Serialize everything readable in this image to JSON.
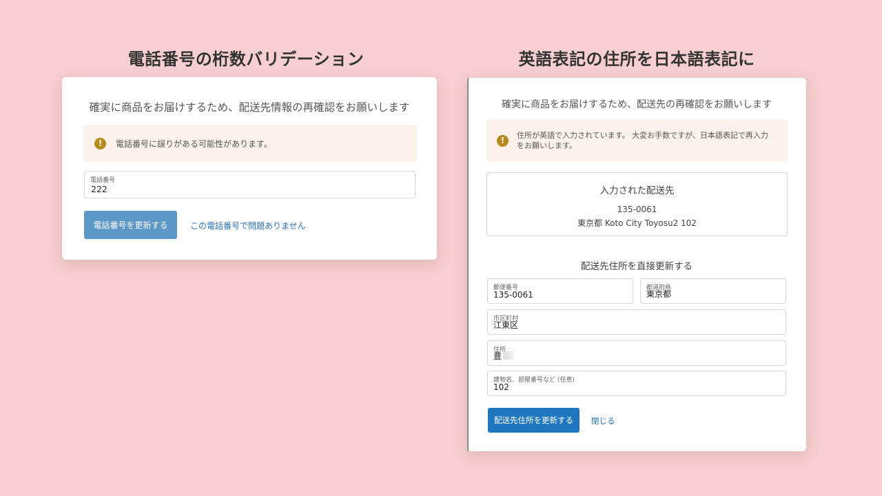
{
  "left_panel": {
    "heading": "電話番号の桁数バリデーション",
    "card_title": "確実に商品をお届けするため、配送先情報の再確認をお願いします",
    "alert_text": "電話番号に誤りがある可能性があります。",
    "phone_field": {
      "label": "電話番号",
      "value": "222"
    },
    "update_button": "電話番号を更新する",
    "ok_link": "この電話番号で問題ありません"
  },
  "right_panel": {
    "heading": "英語表記の住所を日本語表記に",
    "card_title": "確実に商品をお届けするため、配送先の再確認をお願いします",
    "alert_text": "住所が英語で入力されています。 大変お手数ですが、日本語表記で再入力をお願いします。",
    "entered": {
      "title": "入力された配送先",
      "postal": "135-0061",
      "address": "東京都 Koto City Toyosu2 102"
    },
    "direct_update_title": "配送先住所を直接更新する",
    "fields": {
      "postal": {
        "label": "郵便番号",
        "value": "135-0061"
      },
      "prefecture": {
        "label": "都道府県",
        "value": "東京都"
      },
      "city": {
        "label": "市区町村",
        "value": "江東区"
      },
      "street": {
        "label": "住所",
        "value": "豊"
      },
      "building": {
        "label": "建物名、部屋番号など (任意)",
        "value": "102"
      }
    },
    "update_button": "配送先住所を更新する",
    "close_link": "閉じる"
  },
  "icons": {
    "warning": "exclamation-circle-icon"
  },
  "colors": {
    "background": "#f7cfd0",
    "alert_bg": "#fdf2ea",
    "warning": "#b78a1e",
    "primary_button_disabled": "#5b97c9",
    "primary_button": "#1f78bf",
    "link": "#2a73b8"
  }
}
